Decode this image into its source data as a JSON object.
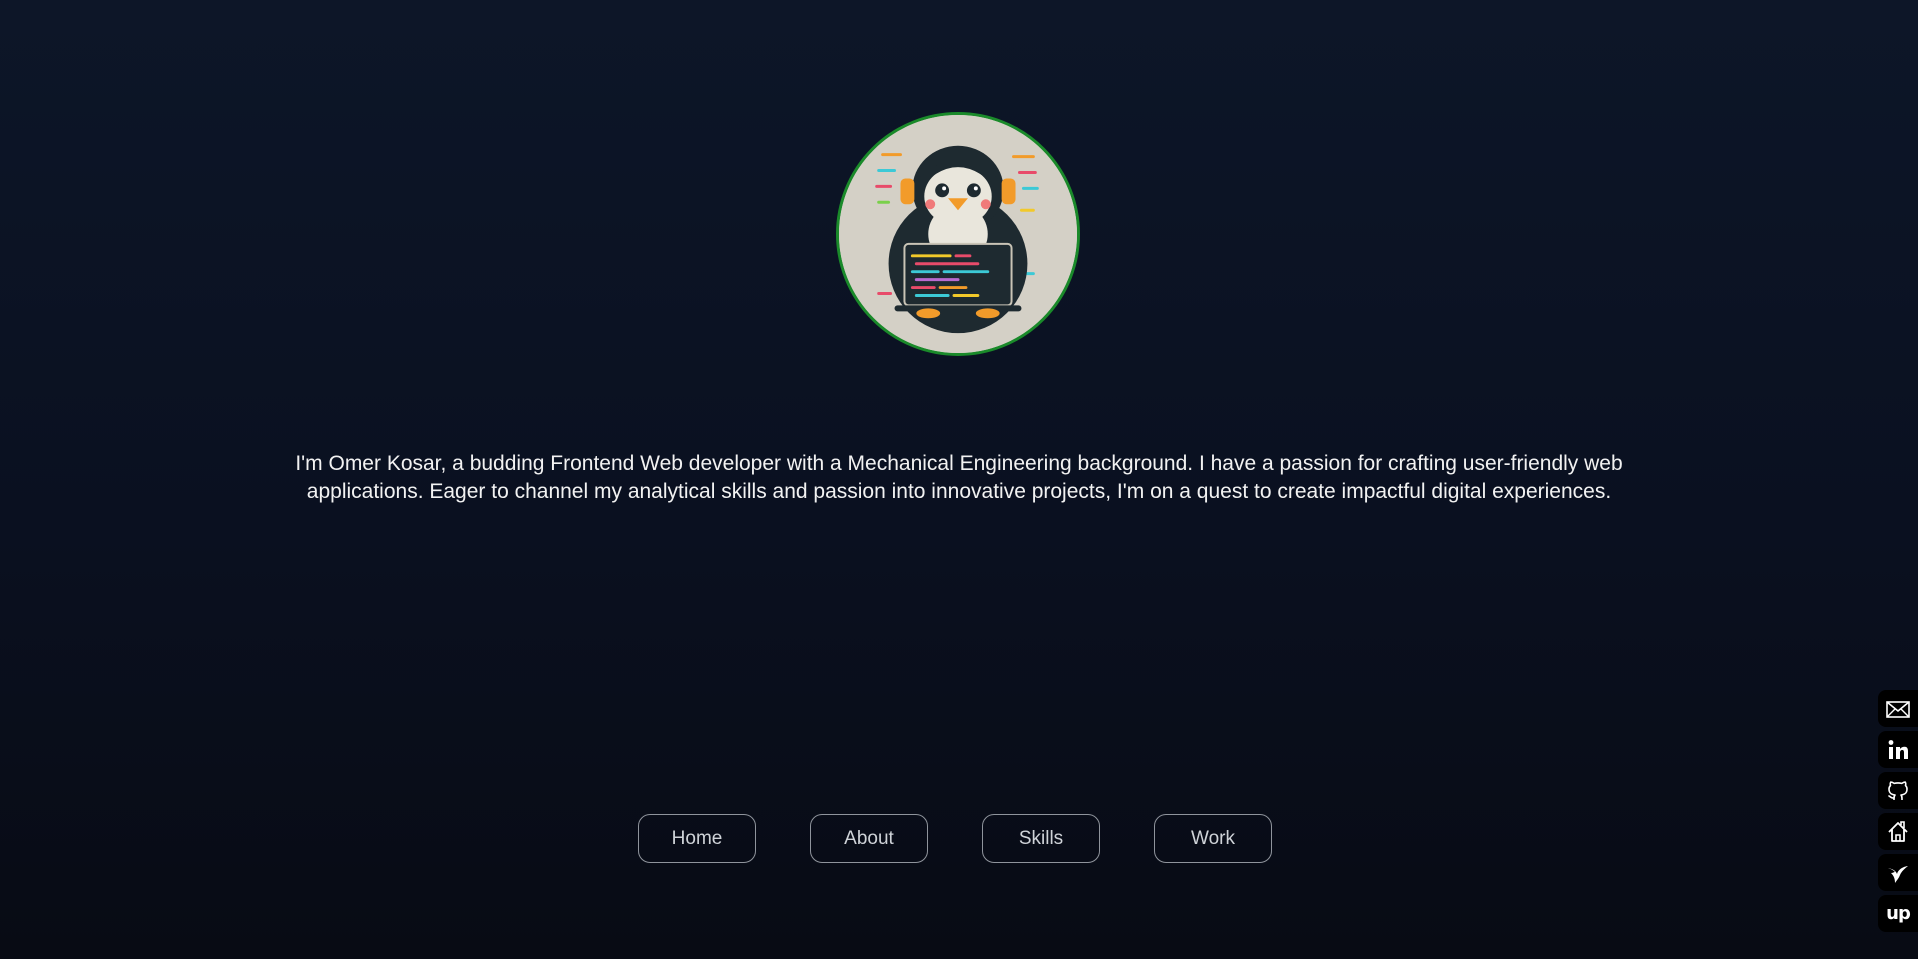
{
  "profile": {
    "avatar_icon": "penguin-developer-avatar",
    "avatar_border_color": "#1a8a2a",
    "bio": "I'm Omer Kosar, a budding Frontend Web developer with a Mechanical Engineering background. I have a passion for crafting user-friendly web applications. Eager to channel my analytical skills and passion into innovative projects, I'm on a quest to create impactful digital experiences."
  },
  "nav": {
    "items": [
      {
        "label": "Home"
      },
      {
        "label": "About"
      },
      {
        "label": "Skills"
      },
      {
        "label": "Work"
      }
    ]
  },
  "social": {
    "items": [
      {
        "icon": "mail-icon"
      },
      {
        "icon": "linkedin-icon"
      },
      {
        "icon": "github-icon"
      },
      {
        "icon": "freecodecamp-icon"
      },
      {
        "icon": "hummingbird-icon"
      },
      {
        "icon": "upwork-icon",
        "text": "up"
      }
    ]
  },
  "colors": {
    "background_top": "#0d1628",
    "background_bottom": "#080b14",
    "button_border": "#8f949c",
    "text": "#f2f2f2"
  }
}
